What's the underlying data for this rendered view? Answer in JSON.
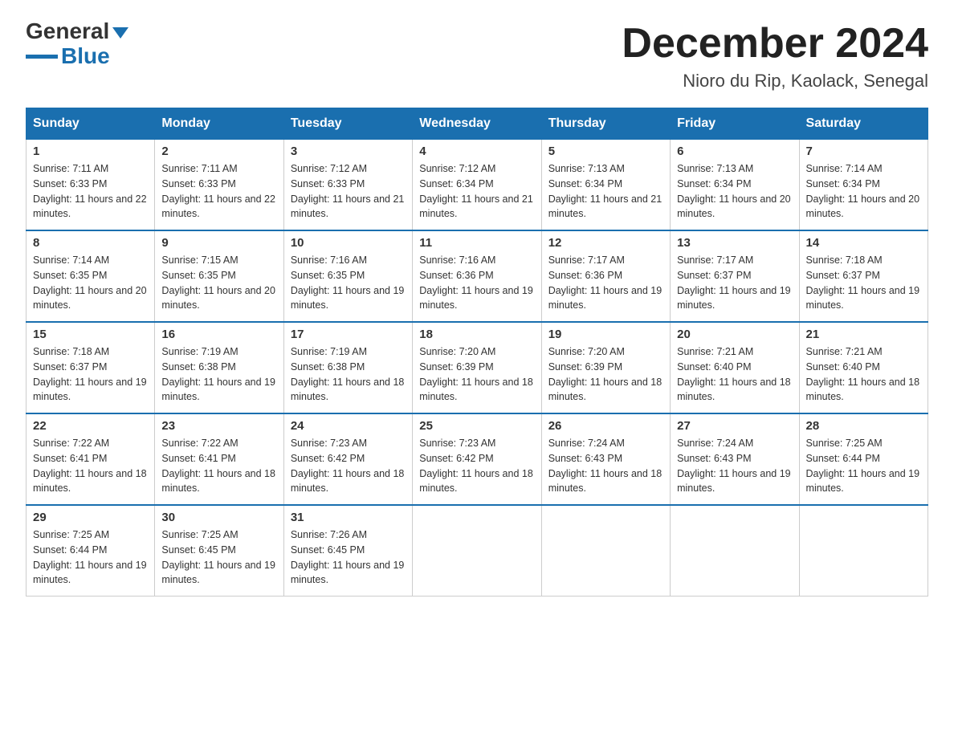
{
  "logo": {
    "general": "General",
    "blue": "Blue"
  },
  "title": "December 2024",
  "location": "Nioro du Rip, Kaolack, Senegal",
  "days_of_week": [
    "Sunday",
    "Monday",
    "Tuesday",
    "Wednesday",
    "Thursday",
    "Friday",
    "Saturday"
  ],
  "weeks": [
    [
      {
        "day": "1",
        "sunrise": "7:11 AM",
        "sunset": "6:33 PM",
        "daylight": "11 hours and 22 minutes."
      },
      {
        "day": "2",
        "sunrise": "7:11 AM",
        "sunset": "6:33 PM",
        "daylight": "11 hours and 22 minutes."
      },
      {
        "day": "3",
        "sunrise": "7:12 AM",
        "sunset": "6:33 PM",
        "daylight": "11 hours and 21 minutes."
      },
      {
        "day": "4",
        "sunrise": "7:12 AM",
        "sunset": "6:34 PM",
        "daylight": "11 hours and 21 minutes."
      },
      {
        "day": "5",
        "sunrise": "7:13 AM",
        "sunset": "6:34 PM",
        "daylight": "11 hours and 21 minutes."
      },
      {
        "day": "6",
        "sunrise": "7:13 AM",
        "sunset": "6:34 PM",
        "daylight": "11 hours and 20 minutes."
      },
      {
        "day": "7",
        "sunrise": "7:14 AM",
        "sunset": "6:34 PM",
        "daylight": "11 hours and 20 minutes."
      }
    ],
    [
      {
        "day": "8",
        "sunrise": "7:14 AM",
        "sunset": "6:35 PM",
        "daylight": "11 hours and 20 minutes."
      },
      {
        "day": "9",
        "sunrise": "7:15 AM",
        "sunset": "6:35 PM",
        "daylight": "11 hours and 20 minutes."
      },
      {
        "day": "10",
        "sunrise": "7:16 AM",
        "sunset": "6:35 PM",
        "daylight": "11 hours and 19 minutes."
      },
      {
        "day": "11",
        "sunrise": "7:16 AM",
        "sunset": "6:36 PM",
        "daylight": "11 hours and 19 minutes."
      },
      {
        "day": "12",
        "sunrise": "7:17 AM",
        "sunset": "6:36 PM",
        "daylight": "11 hours and 19 minutes."
      },
      {
        "day": "13",
        "sunrise": "7:17 AM",
        "sunset": "6:37 PM",
        "daylight": "11 hours and 19 minutes."
      },
      {
        "day": "14",
        "sunrise": "7:18 AM",
        "sunset": "6:37 PM",
        "daylight": "11 hours and 19 minutes."
      }
    ],
    [
      {
        "day": "15",
        "sunrise": "7:18 AM",
        "sunset": "6:37 PM",
        "daylight": "11 hours and 19 minutes."
      },
      {
        "day": "16",
        "sunrise": "7:19 AM",
        "sunset": "6:38 PM",
        "daylight": "11 hours and 19 minutes."
      },
      {
        "day": "17",
        "sunrise": "7:19 AM",
        "sunset": "6:38 PM",
        "daylight": "11 hours and 18 minutes."
      },
      {
        "day": "18",
        "sunrise": "7:20 AM",
        "sunset": "6:39 PM",
        "daylight": "11 hours and 18 minutes."
      },
      {
        "day": "19",
        "sunrise": "7:20 AM",
        "sunset": "6:39 PM",
        "daylight": "11 hours and 18 minutes."
      },
      {
        "day": "20",
        "sunrise": "7:21 AM",
        "sunset": "6:40 PM",
        "daylight": "11 hours and 18 minutes."
      },
      {
        "day": "21",
        "sunrise": "7:21 AM",
        "sunset": "6:40 PM",
        "daylight": "11 hours and 18 minutes."
      }
    ],
    [
      {
        "day": "22",
        "sunrise": "7:22 AM",
        "sunset": "6:41 PM",
        "daylight": "11 hours and 18 minutes."
      },
      {
        "day": "23",
        "sunrise": "7:22 AM",
        "sunset": "6:41 PM",
        "daylight": "11 hours and 18 minutes."
      },
      {
        "day": "24",
        "sunrise": "7:23 AM",
        "sunset": "6:42 PM",
        "daylight": "11 hours and 18 minutes."
      },
      {
        "day": "25",
        "sunrise": "7:23 AM",
        "sunset": "6:42 PM",
        "daylight": "11 hours and 18 minutes."
      },
      {
        "day": "26",
        "sunrise": "7:24 AM",
        "sunset": "6:43 PM",
        "daylight": "11 hours and 18 minutes."
      },
      {
        "day": "27",
        "sunrise": "7:24 AM",
        "sunset": "6:43 PM",
        "daylight": "11 hours and 19 minutes."
      },
      {
        "day": "28",
        "sunrise": "7:25 AM",
        "sunset": "6:44 PM",
        "daylight": "11 hours and 19 minutes."
      }
    ],
    [
      {
        "day": "29",
        "sunrise": "7:25 AM",
        "sunset": "6:44 PM",
        "daylight": "11 hours and 19 minutes."
      },
      {
        "day": "30",
        "sunrise": "7:25 AM",
        "sunset": "6:45 PM",
        "daylight": "11 hours and 19 minutes."
      },
      {
        "day": "31",
        "sunrise": "7:26 AM",
        "sunset": "6:45 PM",
        "daylight": "11 hours and 19 minutes."
      },
      null,
      null,
      null,
      null
    ]
  ],
  "labels": {
    "sunrise": "Sunrise:",
    "sunset": "Sunset:",
    "daylight": "Daylight:"
  }
}
